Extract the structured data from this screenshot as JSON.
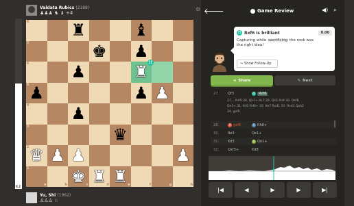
{
  "top_player": {
    "name": "Valdata Rubics",
    "rating": "(2188)",
    "captured": "♟♟♟ ♞ ♝ +4"
  },
  "bottom_player": {
    "name": "Yu, Shi",
    "rating": "(1962)",
    "captured": "♙♙♙ ♘"
  },
  "eval": {
    "value": "0.2",
    "white_fraction": 0.62
  },
  "board": {
    "ranks": [
      [
        "",
        "",
        "bR",
        "",
        "",
        "bB",
        "",
        ""
      ],
      [
        "",
        "",
        "",
        "bK",
        "",
        "bP",
        "",
        ""
      ],
      [
        "",
        "",
        "bP",
        "",
        "",
        "wR",
        "",
        ""
      ],
      [
        "bP",
        "",
        "",
        "",
        "",
        "bP",
        "wP",
        ""
      ],
      [
        "",
        "",
        "bP",
        "",
        "",
        "",
        "",
        ""
      ],
      [
        "",
        "",
        "",
        "",
        "bQ",
        "",
        "",
        ""
      ],
      [
        "wQ",
        "wP",
        "wP",
        "",
        "",
        "",
        "",
        "wP"
      ],
      [
        "",
        "",
        "wK",
        "wR",
        "wR",
        "",
        "",
        ""
      ]
    ],
    "highlights": [
      [
        2,
        5
      ],
      [
        2,
        6
      ]
    ],
    "rank_labels": [
      "8",
      "7",
      "6",
      "5",
      "4",
      "3",
      "2",
      "1"
    ],
    "file_labels": [
      "a",
      "b",
      "c",
      "d",
      "e",
      "f",
      "g",
      "h"
    ]
  },
  "header": {
    "title": "Game Review",
    "back_icon": "arrow-left-icon",
    "sound_icon": "speaker-icon",
    "search_icon": "magnifier-icon"
  },
  "coach": {
    "headline": "Rxf6 is brilliant",
    "score": "0.00",
    "text_pre": "Capturing while ",
    "text_hl": "sacrificing",
    "text_post": " the rook was the right idea!",
    "followup": "Show Follow-Up"
  },
  "buttons": {
    "share": "Share",
    "next": "Next"
  },
  "moves": [
    {
      "num": "27.",
      "white": "Qf3",
      "black": "Rxf6",
      "black_badge": "!!"
    },
    {
      "num": "28.",
      "white": "gxf6",
      "black": "Rh8+",
      "white_badge": "?",
      "black_badge": "!"
    },
    {
      "num": "30.",
      "white": "Re3",
      "black": "Qe1+"
    },
    {
      "num": "31.",
      "white": "Kd3",
      "black": "Qe1+",
      "black_badge": "!"
    },
    {
      "num": "32.",
      "white": "Qxf3+",
      "black": "Kd8"
    }
  ],
  "variation": {
    "line1": "27... Rxf6  28. Qh7+ Rc7  29. Qh5 Rc8  30. Qxf8",
    "line2": "Qe1+ 31. Kd2 Rd6+ 32. Ke7 Rxd1 33. Rxd1 Qxh2",
    "line3": "34. gxf6",
    "line_num": "28."
  },
  "controls": [
    "|◀",
    "◀",
    "▶",
    "▶",
    "▶|"
  ],
  "colors": {
    "brilliant": "#26c2a3",
    "green": "#81b64c",
    "mistake": "#e6563f",
    "good": "#96bc4b",
    "book": "#5c8bb0"
  }
}
